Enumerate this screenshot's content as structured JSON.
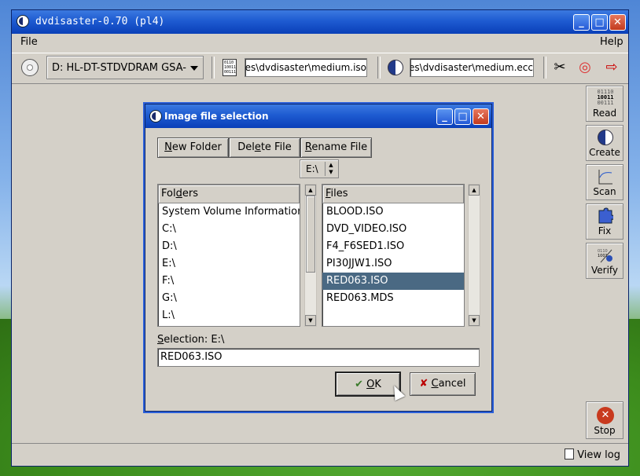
{
  "window": {
    "title": "dvdisaster-0.70 (pl4)",
    "minimize": "_",
    "maximize": "□",
    "close": "✕"
  },
  "menu": {
    "file": "File",
    "help": "Help"
  },
  "toolbar": {
    "drive": "D: HL-DT-STDVDRAM GSA-H",
    "image_path": "iles\\dvdisaster\\medium.iso",
    "ecc_path": "es\\dvdisaster\\medium.ecc",
    "bin_icon": "0110\n10011\n00111",
    "settings_icon": "✂",
    "help_icon": "◎",
    "quit_icon": "⇨"
  },
  "sidebar": {
    "read": "Read",
    "create": "Create",
    "scan": "Scan",
    "fix": "Fix",
    "verify": "Verify",
    "stop": "Stop",
    "read_icon_lines": [
      "01110",
      "10011",
      "00111"
    ],
    "stop_icon": "✕"
  },
  "status": {
    "view_log": "View log"
  },
  "dialog": {
    "title": "Image file selection",
    "buttons": {
      "new_folder_pre": "",
      "new_folder_u": "N",
      "new_folder_post": "ew Folder",
      "delete_pre": "Del",
      "delete_u": "e",
      "delete_post": "te File",
      "rename_pre": "",
      "rename_u": "R",
      "rename_post": "ename File"
    },
    "drive": "E:\\",
    "folders_header_pre": "Fol",
    "folders_header_u": "d",
    "folders_header_post": "ers",
    "files_header_pre": "",
    "files_header_u": "F",
    "files_header_post": "iles",
    "folders": [
      "System Volume Information\\",
      "C:\\",
      "D:\\",
      "E:\\",
      "F:\\",
      "G:\\",
      "L:\\"
    ],
    "files": [
      "BLOOD.ISO",
      "DVD_VIDEO.ISO",
      "F4_F6SED1.ISO",
      "PI30JJW1.ISO",
      "RED063.ISO",
      "RED063.MDS"
    ],
    "selected_file_index": 4,
    "selection_label_pre": "",
    "selection_label_u": "S",
    "selection_label_post": "election: E:\\",
    "selection_value": "RED063.ISO",
    "ok_u": "O",
    "ok_post": "K",
    "cancel_u": "C",
    "cancel_post": "ancel",
    "ok_icon": "✔",
    "cancel_icon": "✘",
    "scroll_up": "▲",
    "scroll_down": "▼",
    "spin_up": "▲",
    "spin_down": "▼"
  }
}
